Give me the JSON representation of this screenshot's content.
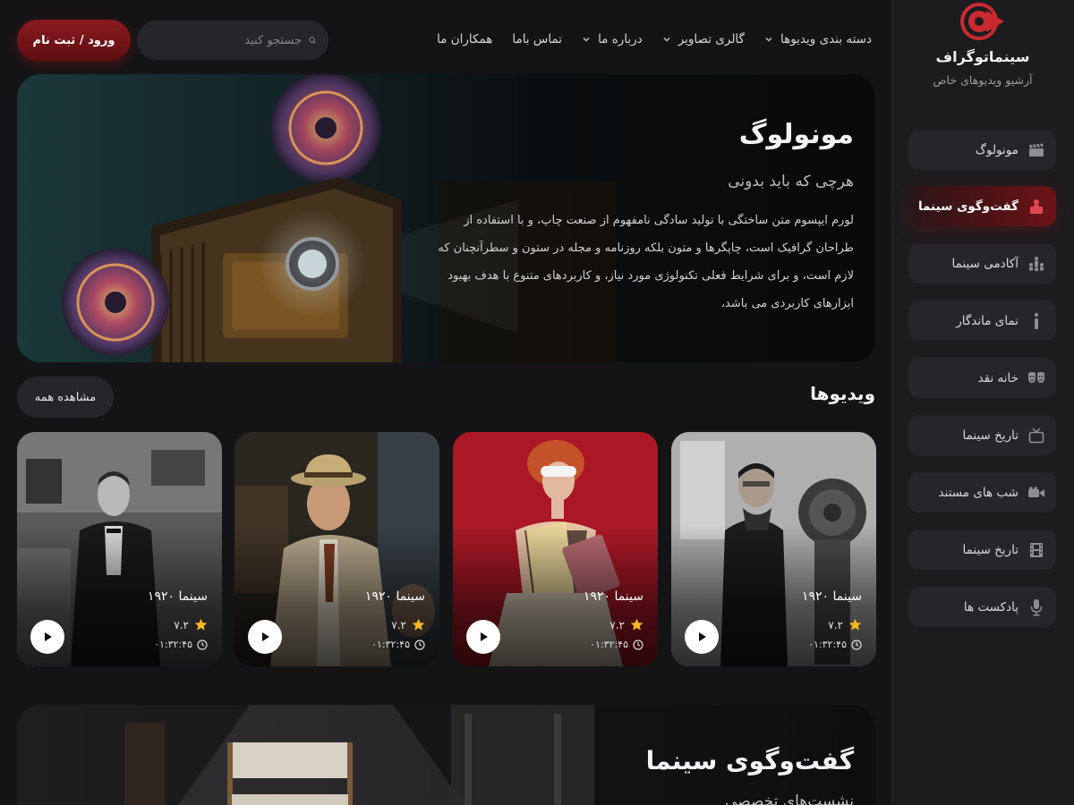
{
  "brand": {
    "name": "سینماتوگراف",
    "subtitle": "آرشیو ویدیوهای خاص"
  },
  "sidebar": {
    "items": [
      {
        "label": "مونولوگ",
        "icon": "clapperboard-icon",
        "active": false
      },
      {
        "label": "گفت‌وگوی سینما",
        "icon": "speaker-podium-icon",
        "active": true
      },
      {
        "label": "آکادمی سینما",
        "icon": "audience-icon",
        "active": false
      },
      {
        "label": "نمای ماندگار",
        "icon": "info-icon",
        "active": false
      },
      {
        "label": "خانه نقد",
        "icon": "theater-masks-icon",
        "active": false
      },
      {
        "label": "تاریخ سینما",
        "icon": "tv-icon",
        "active": false
      },
      {
        "label": "شب های مستند",
        "icon": "video-camera-icon",
        "active": false
      },
      {
        "label": "تاریخ سینما",
        "icon": "film-strip-icon",
        "active": false
      },
      {
        "label": "پادکست ها",
        "icon": "microphone-icon",
        "active": false
      }
    ]
  },
  "nav": {
    "items": [
      {
        "label": "دسته بندی ویدیوها",
        "dropdown": true
      },
      {
        "label": "گالری تصاویر",
        "dropdown": true
      },
      {
        "label": "درباره ما",
        "dropdown": true
      },
      {
        "label": "تماس باما",
        "dropdown": false
      },
      {
        "label": "همکاران ما",
        "dropdown": false
      }
    ]
  },
  "search": {
    "placeholder": "جستجو کنید",
    "value": ""
  },
  "auth": {
    "login_label": "ورود / ثبت نام"
  },
  "hero": {
    "title": "مونولوگ",
    "subtitle": "هرچی که باید بدونی",
    "description": "لورم ایپسوم متن ساختگی با تولید سادگی نامفهوم از صنعت چاپ، و با استفاده از طراحان گرافیک است، چاپگرها و متون بلکه روزنامه و مجله در ستون و سطرآنچنان که لازم است، و برای شرایط فعلی تکنولوژی مورد نیاز، و کاربردهای متنوع با هدف بهبود ابزارهای کاربردی می باشد،"
  },
  "videos": {
    "section_title": "ویدیوها",
    "view_all_label": "مشاهده همه",
    "cards": [
      {
        "title": "سینما ۱۹۲۰",
        "rating": "۷.۲",
        "duration": "۰۱:۳۲:۴۵"
      },
      {
        "title": "سینما ۱۹۲۰",
        "rating": "۷.۲",
        "duration": "۰۱:۳۲:۴۵"
      },
      {
        "title": "سینما ۱۹۲۰",
        "rating": "۷.۲",
        "duration": "۰۱:۳۲:۴۵"
      },
      {
        "title": "سینما ۱۹۲۰",
        "rating": "۷.۲",
        "duration": "۰۱:۳۲:۴۵"
      }
    ]
  },
  "hero2": {
    "title": "گفت‌وگوی سینما",
    "subtitle": "نشست‌های تخصصی"
  },
  "colors": {
    "accent": "#8b1a1e",
    "star": "#f5b820",
    "background": "#141416",
    "sidebar": "#1c1c1f"
  }
}
